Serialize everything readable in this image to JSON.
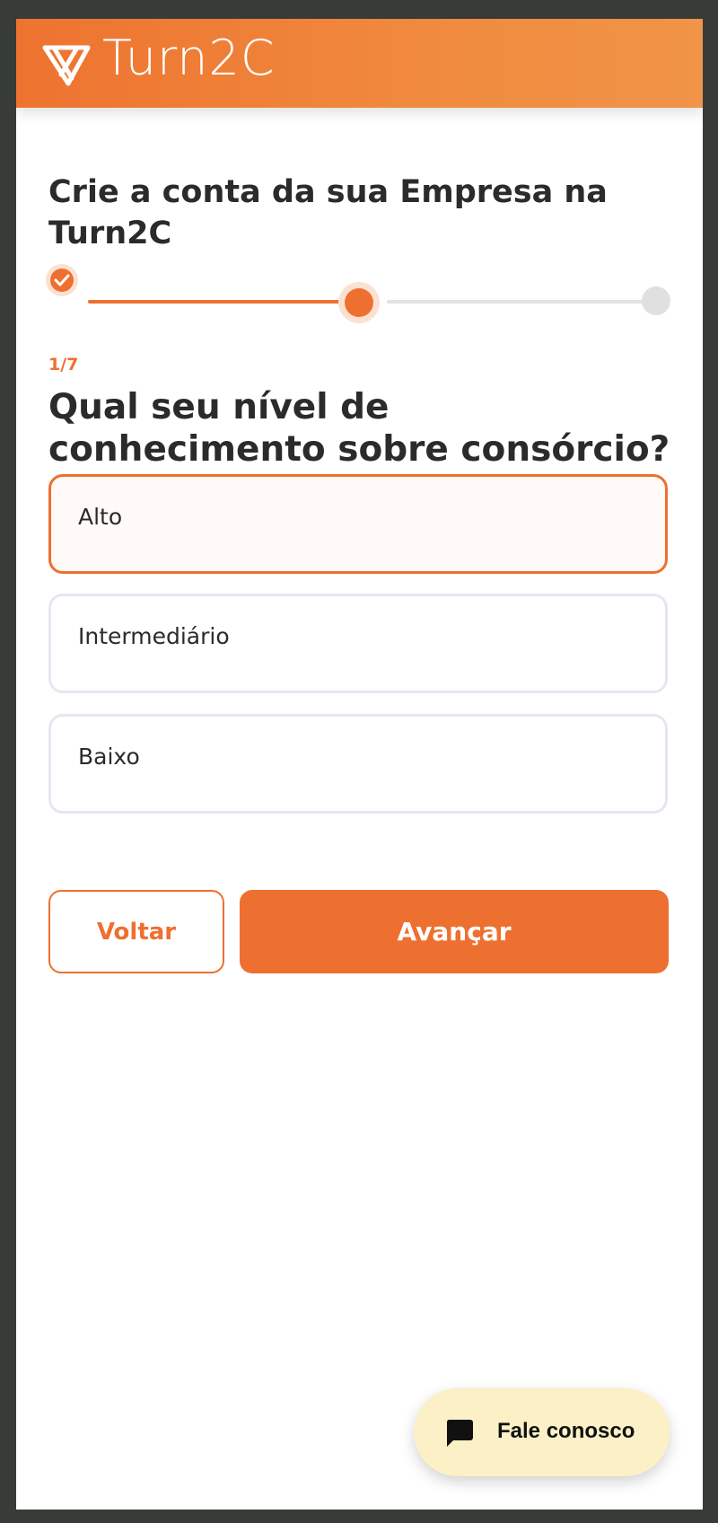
{
  "header": {
    "brand_name": "Turn2C",
    "logo_icon": "turn2c-logo-icon",
    "background_color": "#ee7330"
  },
  "page": {
    "title": "Crie a conta da sua Empresa na Turn2C"
  },
  "stepper": {
    "steps": [
      {
        "state": "done",
        "icon": "check-icon"
      },
      {
        "state": "current"
      },
      {
        "state": "todo"
      }
    ],
    "accent_color": "#ee7030"
  },
  "question": {
    "counter": "1/7",
    "text": "Qual seu nível de conhecimento sobre consórcio?",
    "options": [
      {
        "label": "Alto",
        "selected": true
      },
      {
        "label": "Intermediário",
        "selected": false
      },
      {
        "label": "Baixo",
        "selected": false
      }
    ]
  },
  "actions": {
    "back_label": "Voltar",
    "next_label": "Avançar"
  },
  "chat_widget": {
    "label": "Fale conosco",
    "icon": "chat-bubble-icon",
    "background_color": "#fbf0c6"
  }
}
